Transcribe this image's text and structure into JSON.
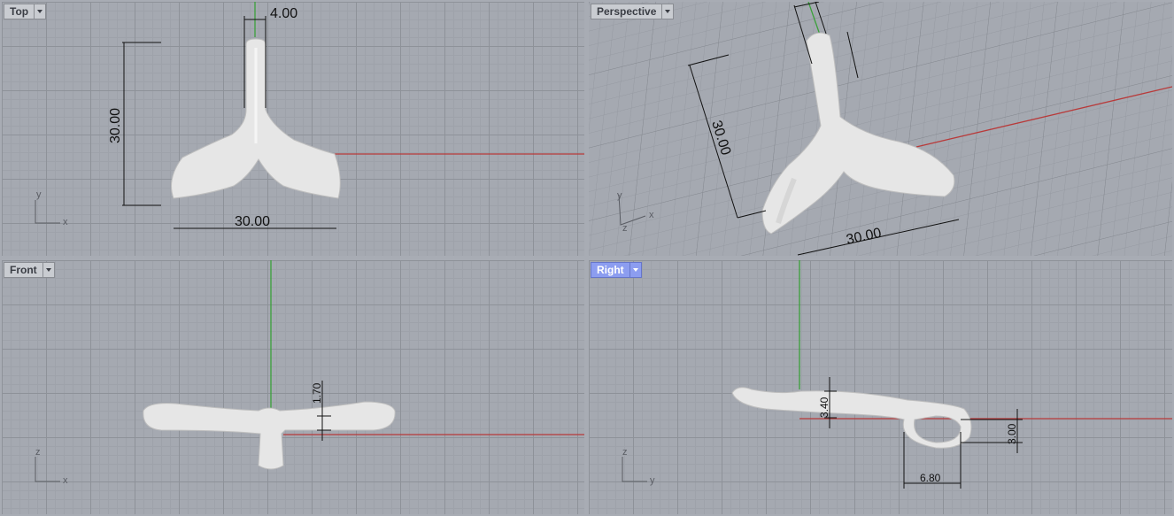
{
  "viewports": {
    "top": {
      "label": "Top"
    },
    "perspective": {
      "label": "Perspective"
    },
    "front": {
      "label": "Front"
    },
    "right": {
      "label": "Right"
    }
  },
  "dimensions": {
    "top_width": "4.00",
    "top_height": "30.00",
    "top_span": "30.00",
    "persp_height": "30.00",
    "persp_span": "30.00",
    "front_thickness": "1.70",
    "right_height": "3.40",
    "right_loop_height": "3.00",
    "right_loop_width": "6.80"
  },
  "axes": {
    "x": "x",
    "y": "y",
    "z": "z"
  },
  "colors": {
    "x_axis": "#b83a3a",
    "y_axis": "#3aa03a",
    "active_tab": "#8c9df0",
    "model": "#e6e6e6"
  }
}
